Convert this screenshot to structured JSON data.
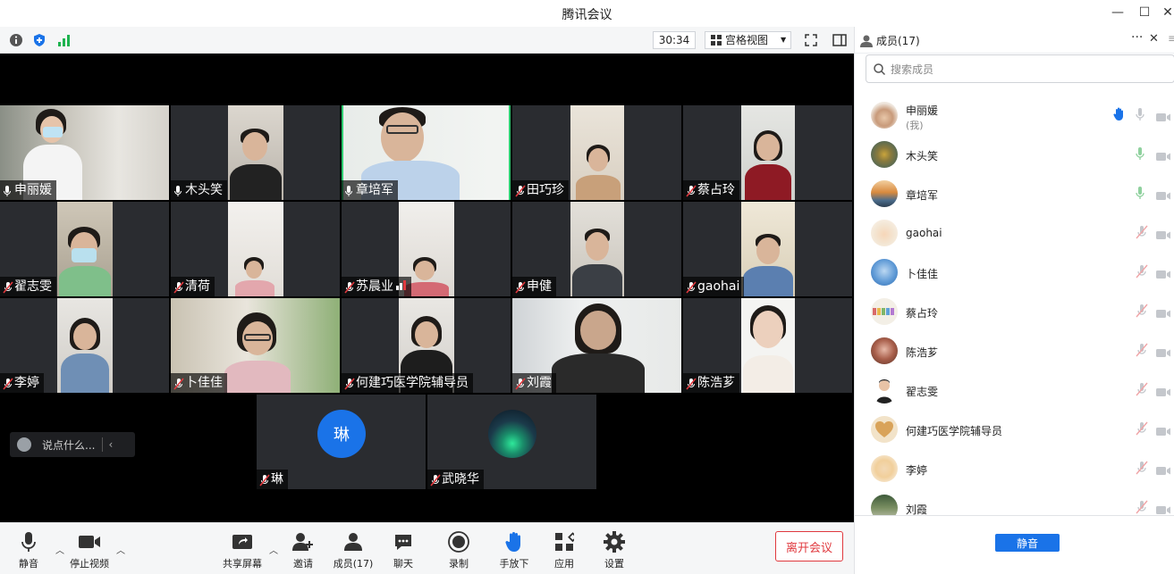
{
  "window": {
    "title": "腾讯会议",
    "min_icon": "minimize-icon",
    "max_icon": "maximize-icon",
    "close_icon": "close-icon"
  },
  "topbar": {
    "timer": "30:34",
    "view_label": "宫格视图"
  },
  "tiles": [
    {
      "name": "申丽媛",
      "mic": "on"
    },
    {
      "name": "木头笑",
      "mic": "on"
    },
    {
      "name": "章培军",
      "mic": "on",
      "active": true
    },
    {
      "name": "田巧珍",
      "mic": "off"
    },
    {
      "name": "蔡占玲",
      "mic": "off"
    },
    {
      "name": "翟志雯",
      "mic": "off"
    },
    {
      "name": "清荷",
      "mic": "off"
    },
    {
      "name": "苏晨业",
      "mic": "off"
    },
    {
      "name": "申健",
      "mic": "off"
    },
    {
      "name": "gaohai",
      "mic": "off"
    },
    {
      "name": "李婷",
      "mic": "off"
    },
    {
      "name": "卜佳佳",
      "mic": "off"
    },
    {
      "name": "何建巧医学院辅导员",
      "mic": "off"
    },
    {
      "name": "刘霞",
      "mic": "off"
    },
    {
      "name": "陈浩芗",
      "mic": "off"
    },
    {
      "name": "琳",
      "mic": "off",
      "avatar_text": "琳"
    },
    {
      "name": "武晓华",
      "mic": "off"
    }
  ],
  "chat": {
    "placeholder": "说点什么..."
  },
  "toolbar": {
    "mute": "静音",
    "stop_video": "停止视频",
    "share": "共享屏幕",
    "invite": "邀请",
    "members": "成员(17)",
    "chat": "聊天",
    "record": "录制",
    "hand_down": "手放下",
    "apps": "应用",
    "settings": "设置",
    "leave": "离开会议"
  },
  "panel": {
    "title": "成员(17)",
    "search_placeholder": "搜索成员",
    "members": [
      {
        "name": "申丽媛",
        "sub": "(我)",
        "hand": true,
        "mic": "gray"
      },
      {
        "name": "木头笑",
        "mic": "green"
      },
      {
        "name": "章培军",
        "mic": "green"
      },
      {
        "name": "gaohai",
        "mic": "muted"
      },
      {
        "name": "卜佳佳",
        "mic": "muted"
      },
      {
        "name": "蔡占玲",
        "mic": "muted"
      },
      {
        "name": "陈浩芗",
        "mic": "muted"
      },
      {
        "name": "翟志雯",
        "mic": "muted"
      },
      {
        "name": "何建巧医学院辅导员",
        "mic": "muted"
      },
      {
        "name": "李婷",
        "mic": "muted"
      },
      {
        "name": "刘霞",
        "mic": "muted"
      }
    ],
    "mute_all": "静音"
  },
  "colors": {
    "accent": "#1a73e8",
    "danger": "#e0393e",
    "active_speaker": "#2ecc71"
  }
}
